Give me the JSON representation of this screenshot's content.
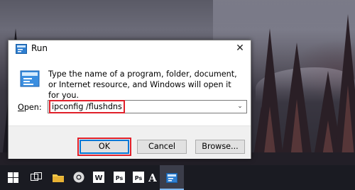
{
  "dialog": {
    "title": "Run",
    "description": "Type the name of a program, folder, document, or Internet resource, and Windows will open it for you.",
    "open_label_prefix": "",
    "open_label_accel": "O",
    "open_label_rest": "pen:",
    "open_value": "ipconfig /flushdns",
    "close_symbol": "✕",
    "dropdown_symbol": "⌄",
    "buttons": {
      "ok": "OK",
      "cancel": "Cancel",
      "browse": "Browse..."
    }
  },
  "highlight_color": "#e0202a",
  "accent_color": "#0078d7",
  "taskbar": {
    "icons": [
      "windows-start-icon",
      "task-view-icon",
      "file-explorer-icon",
      "chrome-icon",
      "word-icon",
      "photoshop-icon",
      "photoshop-icon-2",
      "a-app-icon",
      "run-icon"
    ]
  }
}
